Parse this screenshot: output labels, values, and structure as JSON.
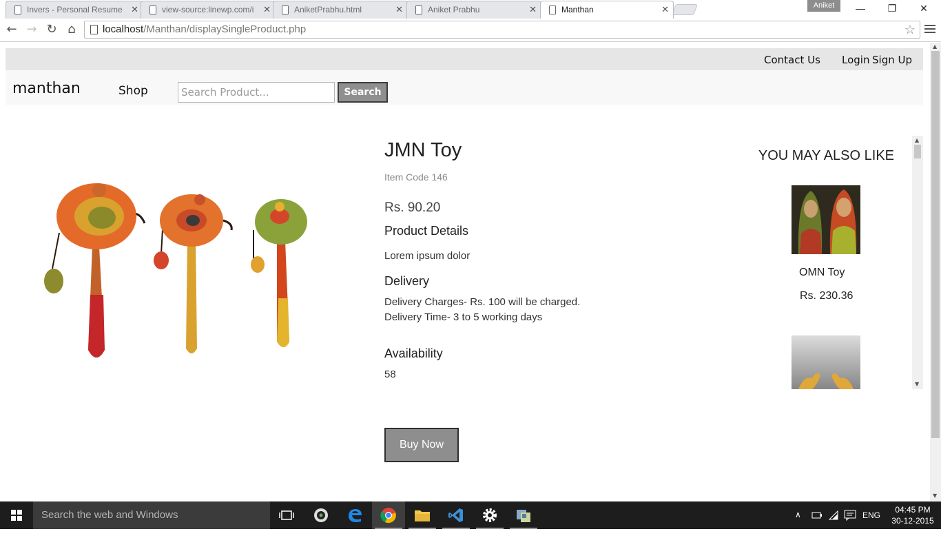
{
  "browser": {
    "tabs": [
      {
        "title": "Invers - Personal Resume",
        "active": false
      },
      {
        "title": "view-source:linewp.com/i",
        "active": false
      },
      {
        "title": "AniketPrabhu.html",
        "active": false
      },
      {
        "title": "Aniket Prabhu",
        "active": false
      },
      {
        "title": "Manthan",
        "active": true
      }
    ],
    "profile_badge": "Aniket",
    "window_controls": {
      "minimize": "—",
      "restore": "❐",
      "close": "✕"
    },
    "url_host": "localhost",
    "url_path": "/Manthan/displaySingleProduct.php"
  },
  "site": {
    "top_links": {
      "contact": "Contact Us",
      "login": "Login",
      "signup": "Sign Up"
    },
    "brand": "manthan",
    "nav_shop": "Shop",
    "search_placeholder": "Search Product...",
    "search_value": "",
    "search_button": "Search"
  },
  "product": {
    "title": "JMN Toy",
    "item_code": "Item Code 146",
    "price": "Rs. 90.20",
    "details_heading": "Product Details",
    "details_text": "Lorem ipsum dolor",
    "delivery_heading": "Delivery",
    "delivery_charges": "Delivery Charges- Rs. 100 will be charged.",
    "delivery_time": "Delivery Time- 3 to 5 working days",
    "availability_heading": "Availability",
    "availability_value": "58",
    "buy_button": "Buy Now"
  },
  "recommendations": {
    "title": "YOU MAY ALSO LIKE",
    "items": [
      {
        "name": "OMN Toy",
        "price": "Rs. 230.36"
      },
      {
        "name": "",
        "price": ""
      }
    ]
  },
  "taskbar": {
    "search_placeholder": "Search the web and Windows",
    "language": "ENG",
    "time": "04:45 PM",
    "date": "30-12-2015"
  },
  "colors": {
    "button_gray": "#8e8e8e",
    "topbar_gray": "#e6e6e6",
    "taskbar": "#1d1d1d"
  }
}
